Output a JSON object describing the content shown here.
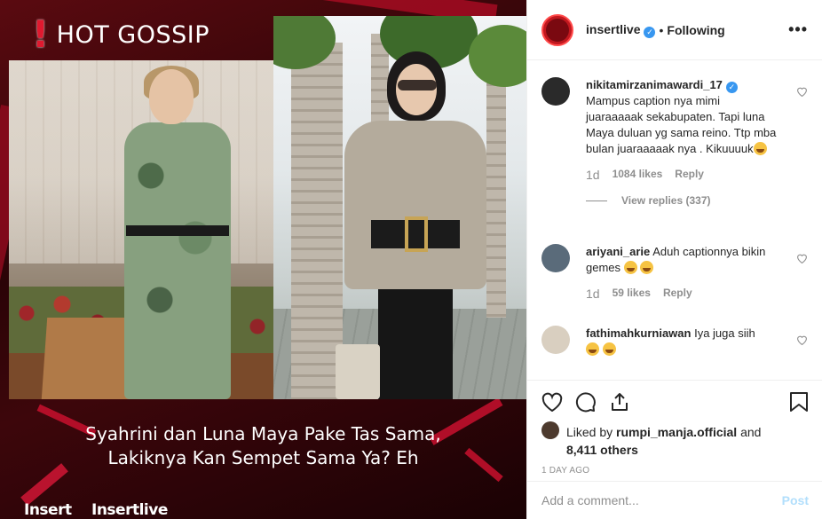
{
  "post": {
    "overlay_title": "HOT GOSSIP",
    "overlay_bang": "!",
    "headline_line1": "Syahrini dan Luna Maya Pake Tas Sama,",
    "headline_line2": "Lakiknya Kan Sempet Sama Ya? Eh",
    "brand_left": "Insert",
    "brand_right": "Insertlive"
  },
  "header": {
    "username": "insertlive",
    "separator": "•",
    "follow_status": "Following",
    "more_label": "•••"
  },
  "comments": [
    {
      "username": "nikitamirzanimawardi_17",
      "verified": true,
      "text": "Mampus caption nya mimi juaraaaaak sekabupaten. Tapi luna Maya duluan yg sama reino. Ttp mba bulan juaraaaaak nya . Kikuuuuk",
      "time": "1d",
      "likes": "1084 likes",
      "reply_label": "Reply",
      "view_replies": "View replies (337)"
    },
    {
      "username": "ariyani_arie",
      "text": "Aduh captionnya bikin gemes",
      "time": "1d",
      "likes": "59 likes",
      "reply_label": "Reply"
    },
    {
      "username": "fathimahkurniawan",
      "text": "Iya juga siih"
    }
  ],
  "likes": {
    "prefix": "Liked by",
    "liker": "rumpi_manja.official",
    "and": "and",
    "others": "8,411 others"
  },
  "date": "1 DAY AGO",
  "add_comment": {
    "placeholder": "Add a comment...",
    "post_label": "Post"
  },
  "colors": {
    "accent_blue": "#3897f0",
    "brand_red": "#c2181f",
    "muted": "#8e8e8e"
  }
}
